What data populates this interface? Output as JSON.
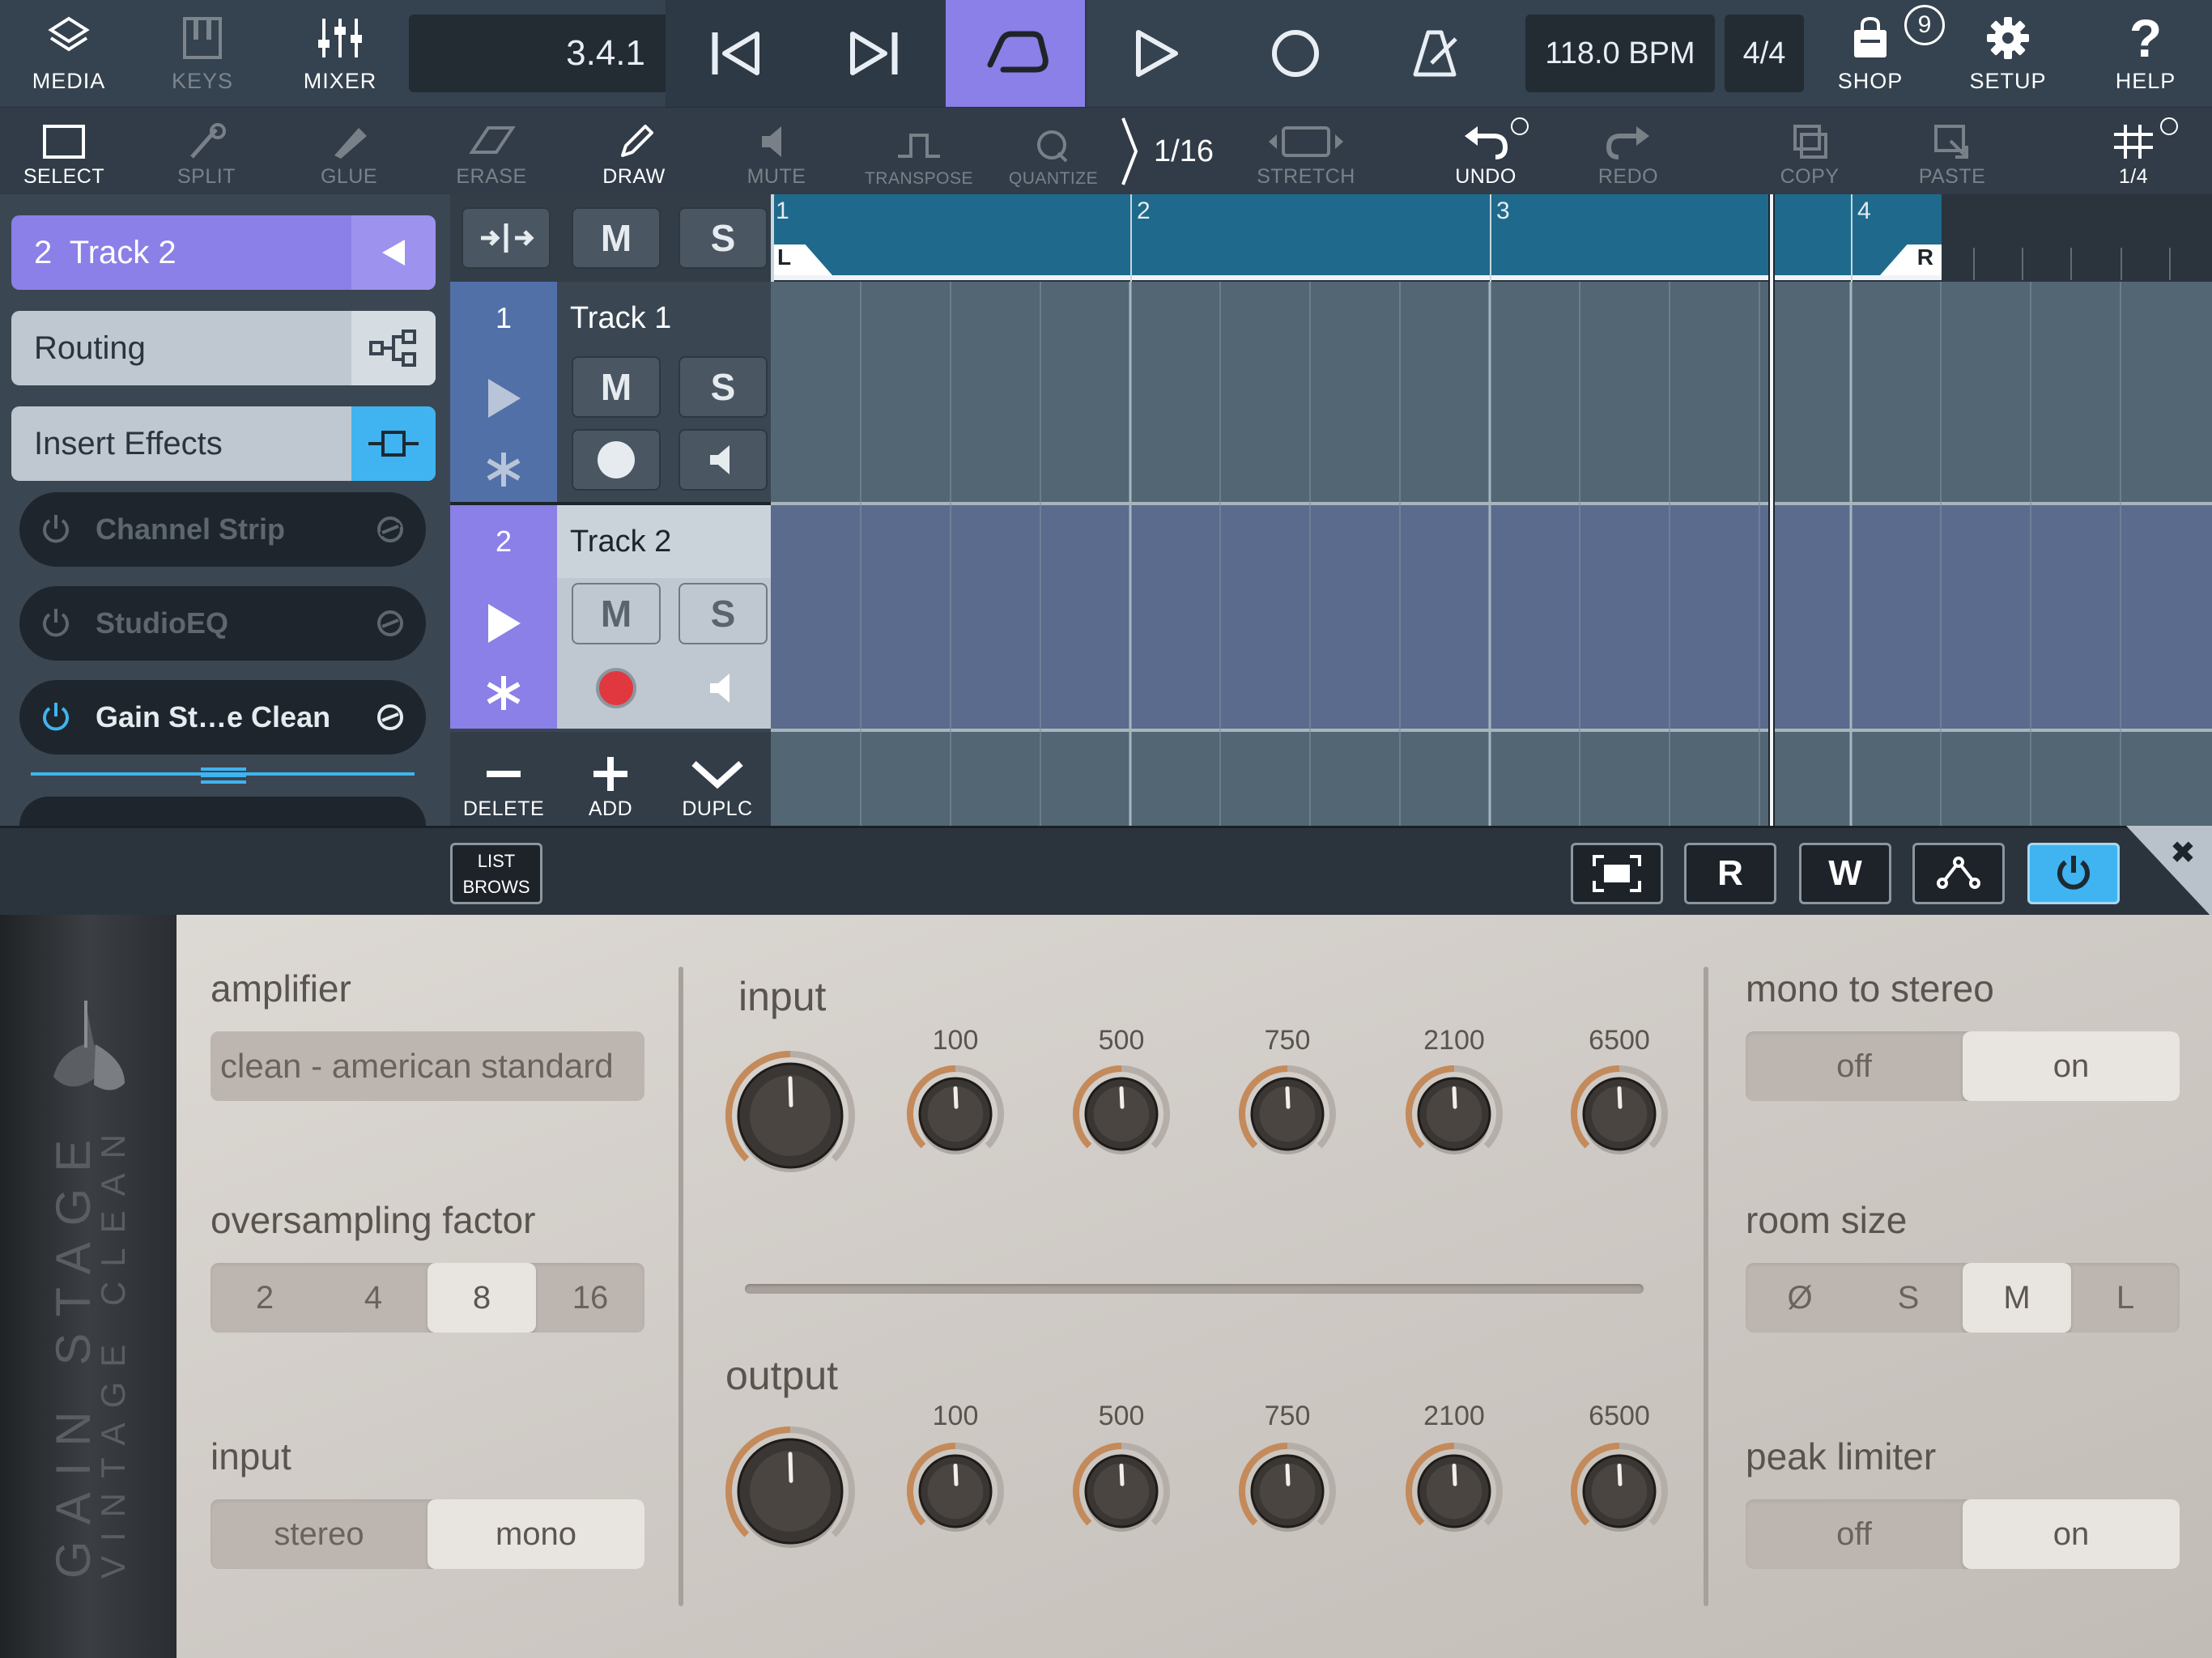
{
  "topbar": {
    "media": "MEDIA",
    "keys": "KEYS",
    "mixer": "MIXER",
    "position": "3.4.1",
    "tempo": "118.0 BPM",
    "signature": "4/4",
    "shop": "SHOP",
    "shop_badge": "9",
    "setup": "SETUP",
    "help": "HELP"
  },
  "tools": {
    "select": "SELECT",
    "split": "SPLIT",
    "glue": "GLUE",
    "erase": "ERASE",
    "draw": "DRAW",
    "mute": "MUTE",
    "transpose": "TRANSPOSE",
    "quantize": "QUANTIZE",
    "quantize_value": "1/16",
    "stretch": "STRETCH",
    "undo": "UNDO",
    "redo": "REDO",
    "copy": "COPY",
    "paste": "PASTE",
    "grid_value": "1/4"
  },
  "inspector": {
    "track_title": "2  Track 2",
    "routing": "Routing",
    "insert_effects": "Insert Effects",
    "effects": [
      {
        "name": "Channel Strip",
        "active": false
      },
      {
        "name": "StudioEQ",
        "active": false
      },
      {
        "name": "Gain St…e Clean",
        "active": true
      }
    ]
  },
  "tracks": {
    "header_m": "M",
    "header_s": "S",
    "items": [
      {
        "number": "1",
        "name": "Track 1",
        "m": "M",
        "s": "S"
      },
      {
        "number": "2",
        "name": "Track 2",
        "m": "M",
        "s": "S"
      }
    ],
    "delete": "DELETE",
    "add": "ADD",
    "duplicate": "DUPLC"
  },
  "ruler": {
    "bars": [
      "1",
      "2",
      "3",
      "4"
    ],
    "left_locator": "L",
    "right_locator": "R"
  },
  "plugin_bar": {
    "list_browse_1": "LIST",
    "list_browse_2": "BROWS",
    "read": "R",
    "write": "W",
    "close": "✖"
  },
  "plugin": {
    "logo_line1": "GAIN STAGE",
    "logo_line2": "VINTAGE CLEAN",
    "amplifier_label": "amplifier",
    "amplifier_value": "clean - american standard",
    "oversampling_label": "oversampling factor",
    "oversampling_options": [
      "2",
      "4",
      "8",
      "16"
    ],
    "oversampling_selected": "8",
    "input_mode_label": "input",
    "input_mode_options": [
      "stereo",
      "mono"
    ],
    "input_mode_selected": "mono",
    "input_section": "input",
    "output_section": "output",
    "band_labels": [
      "100",
      "500",
      "750",
      "2100",
      "6500"
    ],
    "mono_to_stereo_label": "mono to stereo",
    "mono_to_stereo_options": [
      "off",
      "on"
    ],
    "mono_to_stereo_selected": "on",
    "room_size_label": "room size",
    "room_size_options": [
      "Ø",
      "S",
      "M",
      "L"
    ],
    "room_size_selected": "M",
    "peak_limiter_label": "peak limiter",
    "peak_limiter_options": [
      "off",
      "on"
    ],
    "peak_limiter_selected": "on"
  },
  "colors": {
    "accent_purple": "#8b7fe8",
    "accent_blue": "#3fb4f0",
    "record_red": "#e0383e"
  }
}
